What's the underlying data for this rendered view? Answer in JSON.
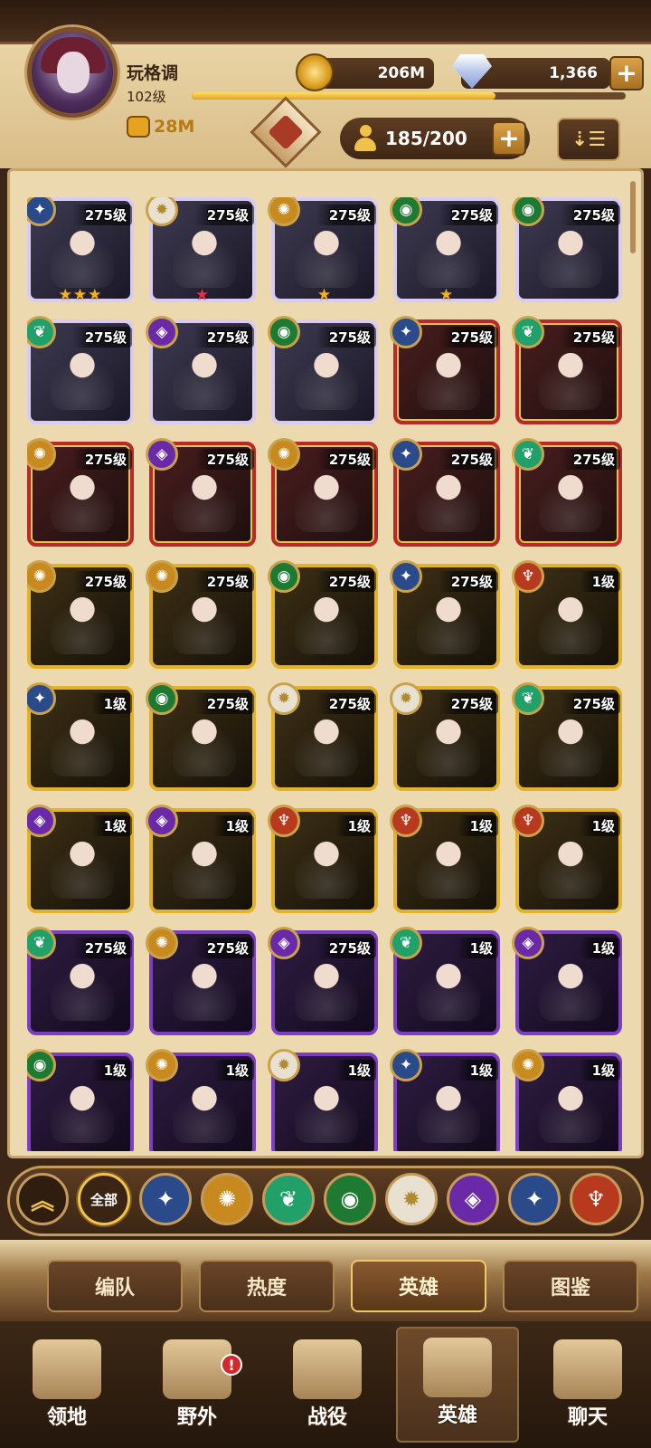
{
  "player": {
    "name": "玩格调",
    "level": "102级",
    "power": "28M",
    "xp_fraction": 0.7
  },
  "currency": {
    "gold": "206M",
    "gems": "1,366"
  },
  "roster": {
    "count": "185/200"
  },
  "icons": {
    "sort": "sort-icon",
    "person": "person-icon",
    "coin": "gold-coin-icon",
    "gem": "diamond-icon"
  },
  "colors": {
    "accent": "#c49b5c",
    "panel": "#ecd9b0",
    "lvl_text": "#ffffff"
  },
  "heroes": [
    {
      "level": "275级",
      "rarity": "r-purple",
      "faction": "celestial",
      "stars": "★★★",
      "star_color": "gold"
    },
    {
      "level": "275级",
      "rarity": "r-purple",
      "faction": "light",
      "stars": "★",
      "star_color": "red"
    },
    {
      "level": "275级",
      "rarity": "r-purple",
      "faction": "wilder",
      "stars": "★",
      "star_color": "gold"
    },
    {
      "level": "275级",
      "rarity": "r-purple",
      "faction": "maulers",
      "stars": "★",
      "star_color": "gold"
    },
    {
      "level": "275级",
      "rarity": "r-purple",
      "faction": "maulers",
      "stars": "",
      "star_color": ""
    },
    {
      "level": "275级",
      "rarity": "r-purple",
      "faction": "lightbearer",
      "stars": "",
      "star_color": ""
    },
    {
      "level": "275级",
      "rarity": "r-purple",
      "faction": "graveborn",
      "stars": "",
      "star_color": ""
    },
    {
      "level": "275级",
      "rarity": "r-purple",
      "faction": "maulers",
      "stars": "",
      "star_color": ""
    },
    {
      "level": "275级",
      "rarity": "r-red",
      "faction": "celestial",
      "stars": "",
      "star_color": ""
    },
    {
      "level": "275级",
      "rarity": "r-red",
      "faction": "lightbearer",
      "stars": "",
      "star_color": ""
    },
    {
      "level": "275级",
      "rarity": "r-red",
      "faction": "wilder",
      "stars": "",
      "star_color": ""
    },
    {
      "level": "275级",
      "rarity": "r-red",
      "faction": "graveborn",
      "stars": "",
      "star_color": ""
    },
    {
      "level": "275级",
      "rarity": "r-red",
      "faction": "wilder",
      "stars": "",
      "star_color": ""
    },
    {
      "level": "275级",
      "rarity": "r-red",
      "faction": "celestial",
      "stars": "",
      "star_color": ""
    },
    {
      "level": "275级",
      "rarity": "r-red",
      "faction": "lightbearer",
      "stars": "",
      "star_color": ""
    },
    {
      "level": "275级",
      "rarity": "r-gold",
      "faction": "wilder",
      "stars": "",
      "star_color": ""
    },
    {
      "level": "275级",
      "rarity": "r-gold",
      "faction": "wilder",
      "stars": "",
      "star_color": ""
    },
    {
      "level": "275级",
      "rarity": "r-gold",
      "faction": "maulers",
      "stars": "",
      "star_color": ""
    },
    {
      "level": "275级",
      "rarity": "r-gold",
      "faction": "celestial",
      "stars": "",
      "star_color": ""
    },
    {
      "level": "1级",
      "rarity": "r-gold",
      "faction": "hypogean",
      "stars": "",
      "star_color": ""
    },
    {
      "level": "1级",
      "rarity": "r-gold",
      "faction": "celestial",
      "stars": "",
      "star_color": ""
    },
    {
      "level": "275级",
      "rarity": "r-gold",
      "faction": "maulers",
      "stars": "",
      "star_color": ""
    },
    {
      "level": "275级",
      "rarity": "r-gold",
      "faction": "light",
      "stars": "",
      "star_color": ""
    },
    {
      "level": "275级",
      "rarity": "r-gold",
      "faction": "light",
      "stars": "",
      "star_color": ""
    },
    {
      "level": "275级",
      "rarity": "r-gold",
      "faction": "lightbearer",
      "stars": "",
      "star_color": ""
    },
    {
      "level": "1级",
      "rarity": "r-gold",
      "faction": "graveborn",
      "stars": "",
      "star_color": ""
    },
    {
      "level": "1级",
      "rarity": "r-gold",
      "faction": "graveborn",
      "stars": "",
      "star_color": ""
    },
    {
      "level": "1级",
      "rarity": "r-gold",
      "faction": "hypogean",
      "stars": "",
      "star_color": ""
    },
    {
      "level": "1级",
      "rarity": "r-gold",
      "faction": "hypogean",
      "stars": "",
      "star_color": ""
    },
    {
      "level": "1级",
      "rarity": "r-gold",
      "faction": "hypogean",
      "stars": "",
      "star_color": ""
    },
    {
      "level": "275级",
      "rarity": "r-violet",
      "faction": "lightbearer",
      "stars": "",
      "star_color": ""
    },
    {
      "level": "275级",
      "rarity": "r-violet",
      "faction": "wilder",
      "stars": "",
      "star_color": ""
    },
    {
      "level": "275级",
      "rarity": "r-violet",
      "faction": "graveborn",
      "stars": "",
      "star_color": ""
    },
    {
      "level": "1级",
      "rarity": "r-violet",
      "faction": "lightbearer",
      "stars": "",
      "star_color": ""
    },
    {
      "level": "1级",
      "rarity": "r-violet",
      "faction": "graveborn",
      "stars": "",
      "star_color": ""
    },
    {
      "level": "1级",
      "rarity": "r-violet",
      "faction": "maulers",
      "stars": "",
      "star_color": ""
    },
    {
      "level": "1级",
      "rarity": "r-violet",
      "faction": "wilder",
      "stars": "",
      "star_color": ""
    },
    {
      "level": "1级",
      "rarity": "r-violet",
      "faction": "light",
      "stars": "",
      "star_color": ""
    },
    {
      "level": "1级",
      "rarity": "r-violet",
      "faction": "celestial",
      "stars": "",
      "star_color": ""
    },
    {
      "level": "1级",
      "rarity": "r-violet",
      "faction": "wilder",
      "stars": "",
      "star_color": ""
    }
  ],
  "faction_styles": {
    "celestial": {
      "bg": "#2a4a8a",
      "glyph": "✦"
    },
    "light": {
      "bg": "#e8e0d0",
      "glyph": "✹"
    },
    "wilder": {
      "bg": "#c88a1e",
      "glyph": "✺"
    },
    "maulers": {
      "bg": "#1e7a32",
      "glyph": "◉"
    },
    "lightbearer": {
      "bg": "#22a06a",
      "glyph": "❦"
    },
    "graveborn": {
      "bg": "#6a2aa8",
      "glyph": "◈"
    },
    "hypogean": {
      "bg": "#b83a1e",
      "glyph": "♆"
    }
  },
  "filters": [
    {
      "label": "",
      "kind": "up",
      "icon": "collapse-icon"
    },
    {
      "label": "全部",
      "kind": "all",
      "icon": "all-filter"
    },
    {
      "label": "",
      "kind": "celestial",
      "icon": "celestial-icon"
    },
    {
      "label": "",
      "kind": "wilder",
      "icon": "wilder-icon"
    },
    {
      "label": "",
      "kind": "lightbearer",
      "icon": "lightbearer-icon"
    },
    {
      "label": "",
      "kind": "maulers",
      "icon": "maulers-icon"
    },
    {
      "label": "",
      "kind": "light",
      "icon": "light-icon"
    },
    {
      "label": "",
      "kind": "graveborn",
      "icon": "graveborn-icon"
    },
    {
      "label": "",
      "kind": "celestial",
      "icon": "dimensional-icon"
    },
    {
      "label": "",
      "kind": "hypogean",
      "icon": "hypogean-icon"
    }
  ],
  "tabs": [
    "编队",
    "热度",
    "英雄",
    "图鉴"
  ],
  "active_tab": 2,
  "nav": [
    {
      "label": "领地",
      "icon": "castle-icon"
    },
    {
      "label": "野外",
      "icon": "scroll-map-icon",
      "badge": "!"
    },
    {
      "label": "战役",
      "icon": "sword-wings-icon"
    },
    {
      "label": "英雄",
      "icon": "helmet-icon"
    },
    {
      "label": "聊天",
      "icon": "chat-bubble-icon"
    }
  ],
  "active_nav": 3
}
